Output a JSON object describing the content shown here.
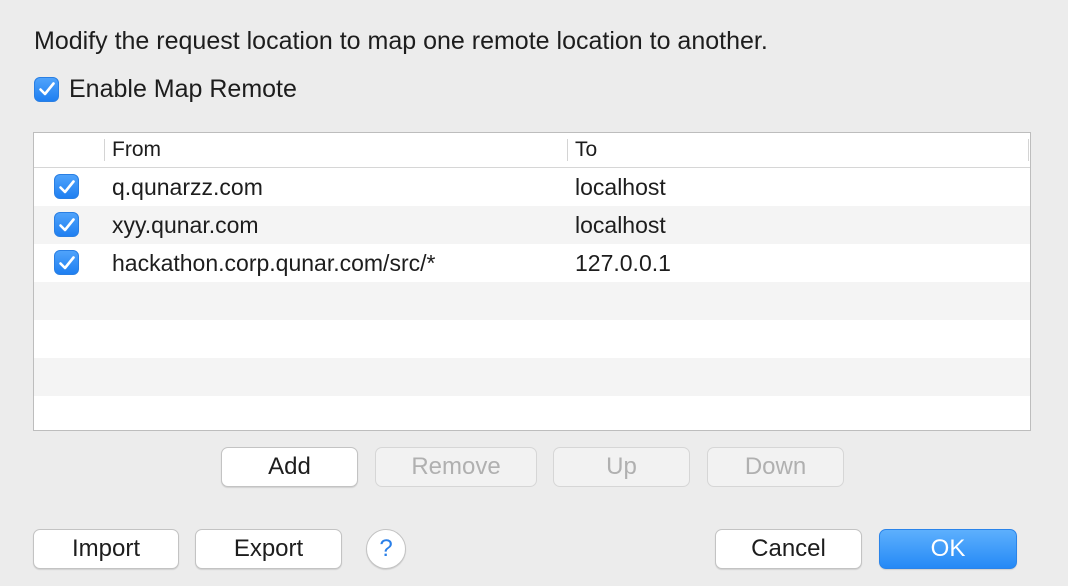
{
  "description": "Modify the request location to map one remote location to another.",
  "enable": {
    "label": "Enable Map Remote",
    "checked": true
  },
  "table": {
    "columns": [
      "From",
      "To"
    ],
    "rows": [
      {
        "enabled": true,
        "from": "q.qunarzz.com",
        "to": "localhost"
      },
      {
        "enabled": true,
        "from": "xyy.qunar.com",
        "to": "localhost"
      },
      {
        "enabled": true,
        "from": "hackathon.corp.qunar.com/src/*",
        "to": "127.0.0.1"
      }
    ]
  },
  "list_buttons": {
    "add": "Add",
    "remove": "Remove",
    "up": "Up",
    "down": "Down"
  },
  "footer": {
    "import": "Import",
    "export": "Export",
    "help": "?",
    "cancel": "Cancel",
    "ok": "OK"
  },
  "colors": {
    "accent": "#1f7ff1",
    "background": "#ececec"
  },
  "icons": {
    "check": "checkmark-icon",
    "help": "question-icon"
  }
}
